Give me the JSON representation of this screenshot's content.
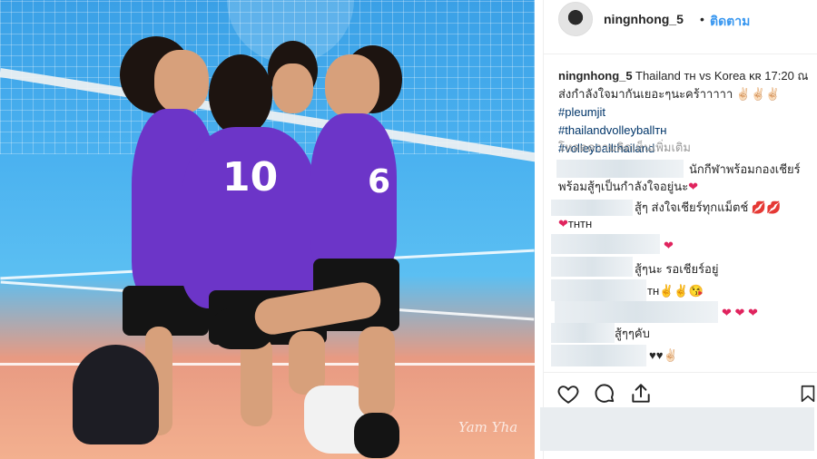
{
  "post": {
    "username": "ningnhong_5",
    "separator": "•",
    "follow_label": "ติดตาม",
    "caption_user": "ningnhong_5",
    "caption_text": "Thailand ᴛʜ vs Korea ᴋʀ 17:20 ณ ส่งกำลังใจมากันเยอะๆนะคร้าาาาา ✌🏻✌🏻✌🏻",
    "hashtags": [
      "#pleumjit",
      "#thailandvolleyballᴛʜ",
      "#volleyballthailand"
    ],
    "load_more": "โหลดความคิดเห็นเพิ่มเติม",
    "photo_watermark": "Yam Yha"
  },
  "comments": [
    {
      "text": "นักกีฬาพร้อมกองเชียร์",
      "cont": "พร้อมสู้ๆเป็นกำลังใจอยู่นะ",
      "emoji": "❤"
    },
    {
      "text": "สู้ๆ ส่งใจเชียร์ทุกแม็ตช์",
      "emoji": "💋💋"
    },
    {
      "text": "ᴛʜᴛʜ",
      "emoji": "❤"
    },
    {
      "text": "",
      "emoji": "❤"
    },
    {
      "text": "สู้ๆนะ รอเชียร์อยู่",
      "emoji": ""
    },
    {
      "text": "ᴛʜ",
      "emoji": "✌✌😘"
    },
    {
      "text": "",
      "emoji": "❤ ❤ ❤"
    },
    {
      "text": "สู้ๆๆคับ",
      "emoji": ""
    },
    {
      "text": "",
      "emoji": "♥♥✌🏻"
    }
  ],
  "icons": {
    "like": "heart-outline-icon",
    "comment": "speech-bubble-icon",
    "share": "share-upload-icon",
    "save": "bookmark-icon"
  },
  "colors": {
    "link": "#3897f0",
    "hashtag": "#003569",
    "jersey": "#6c35c8"
  }
}
